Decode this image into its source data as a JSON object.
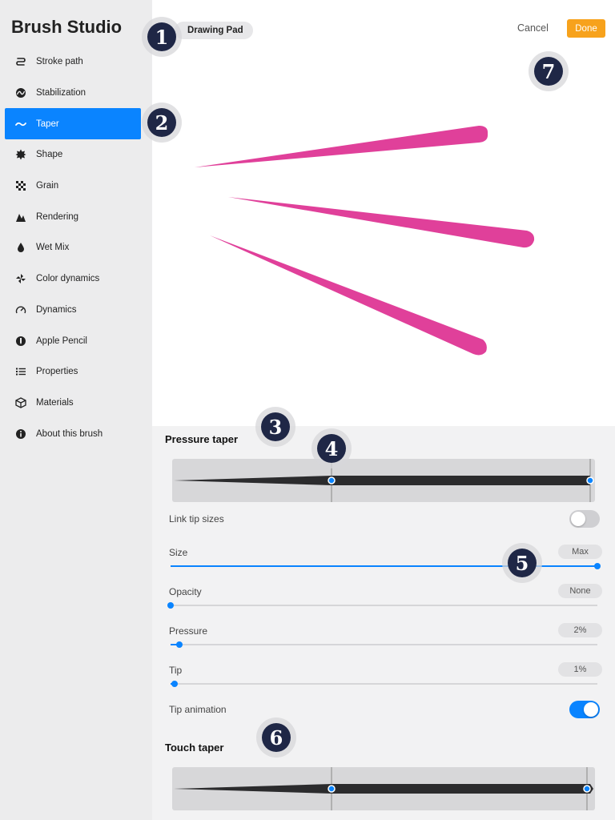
{
  "app": {
    "title": "Brush Studio"
  },
  "header": {
    "chip_label": "Drawing Pad",
    "cancel_label": "Cancel",
    "done_label": "Done"
  },
  "sidebar": {
    "active_index": 2,
    "items": [
      {
        "label": "Stroke path",
        "icon": "stroke-path-icon"
      },
      {
        "label": "Stabilization",
        "icon": "stabilization-icon"
      },
      {
        "label": "Taper",
        "icon": "taper-icon"
      },
      {
        "label": "Shape",
        "icon": "shape-icon"
      },
      {
        "label": "Grain",
        "icon": "grain-icon"
      },
      {
        "label": "Rendering",
        "icon": "rendering-icon"
      },
      {
        "label": "Wet Mix",
        "icon": "wet-mix-icon"
      },
      {
        "label": "Color dynamics",
        "icon": "color-dynamics-icon"
      },
      {
        "label": "Dynamics",
        "icon": "dynamics-icon"
      },
      {
        "label": "Apple Pencil",
        "icon": "apple-pencil-icon"
      },
      {
        "label": "Properties",
        "icon": "properties-icon"
      },
      {
        "label": "Materials",
        "icon": "materials-icon"
      },
      {
        "label": "About this brush",
        "icon": "info-icon"
      }
    ]
  },
  "pressure_taper": {
    "title": "Pressure taper",
    "link_tip_sizes": {
      "label": "Link tip sizes",
      "on": false
    },
    "size": {
      "label": "Size",
      "value": "Max",
      "fraction": 1.0
    },
    "opacity": {
      "label": "Opacity",
      "value": "None",
      "fraction": 0.0
    },
    "pressure": {
      "label": "Pressure",
      "value": "2%",
      "fraction": 0.02
    },
    "tip": {
      "label": "Tip",
      "value": "1%",
      "fraction": 0.01
    },
    "tip_animation": {
      "label": "Tip animation",
      "on": true
    }
  },
  "touch_taper": {
    "title": "Touch taper"
  },
  "markers": [
    "1",
    "2",
    "3",
    "4",
    "5",
    "6",
    "7"
  ],
  "colors": {
    "accent": "#0a84ff",
    "done": "#f7a21c",
    "stroke": "#e0409a",
    "marker": "#1f2746"
  }
}
